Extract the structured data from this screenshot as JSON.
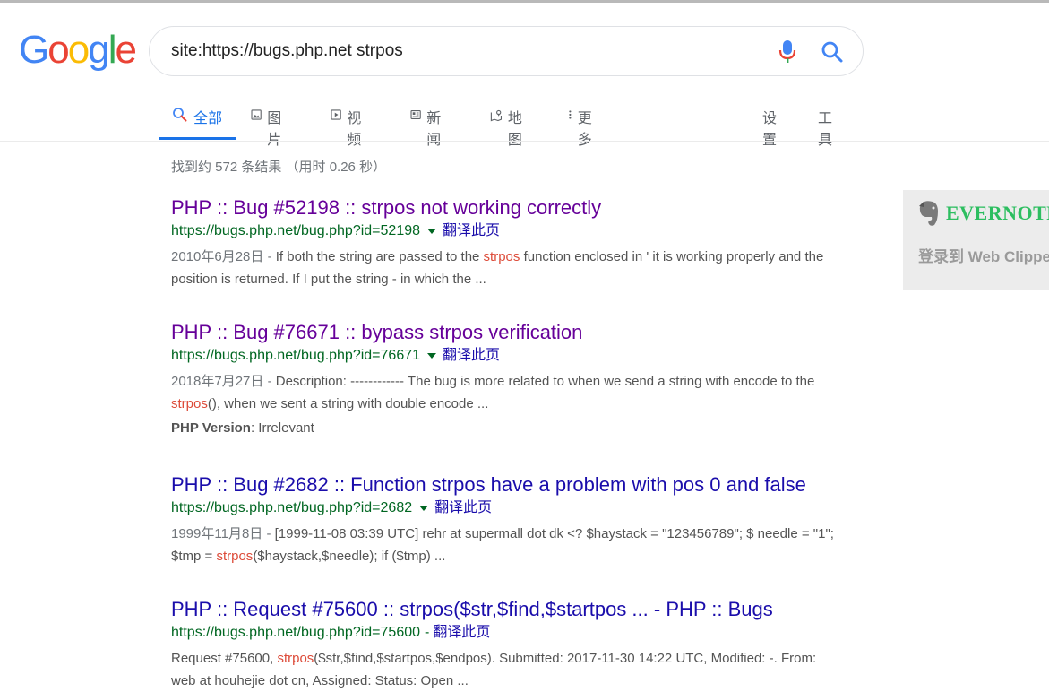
{
  "logo": {
    "letters": [
      "G",
      "o",
      "o",
      "g",
      "l",
      "e"
    ],
    "colors": [
      "#4285F4",
      "#EA4335",
      "#FBBC05",
      "#4285F4",
      "#34A853",
      "#EA4335"
    ]
  },
  "search": {
    "query": "site:https://bugs.php.net strpos"
  },
  "tabs": [
    {
      "label": "全部",
      "icon": "search-icon",
      "active": true
    },
    {
      "label": "图片",
      "icon": "image-icon"
    },
    {
      "label": "视频",
      "icon": "video-icon"
    },
    {
      "label": "新闻",
      "icon": "news-icon"
    },
    {
      "label": "地图",
      "icon": "map-icon"
    },
    {
      "label": "更多",
      "icon": "more-vert-icon"
    }
  ],
  "tools": {
    "settings": "设置",
    "tools": "工具"
  },
  "stats": "找到约 572 条结果 （用时 0.26 秒）",
  "results": [
    {
      "title": "PHP :: Bug #52198 :: strpos not working correctly",
      "visited": true,
      "url": "https://bugs.php.net/bug.php?id=52198",
      "translate": "翻译此页",
      "date": "2010年6月28日 - ",
      "snippet_parts": [
        "If both the string are passed to the ",
        "strpos",
        " function enclosed in ' it is working properly and the position is returned. If I put the string - in which the ..."
      ]
    },
    {
      "title": "PHP :: Bug #76671 :: bypass strpos verification",
      "visited": true,
      "url": "https://bugs.php.net/bug.php?id=76671",
      "translate": "翻译此页",
      "date": "2018年7月27日 - ",
      "snippet_parts": [
        "Description: ------------ The bug is more related to when we send a string with encode to the ",
        "strpos",
        "(), when we sent a string with double encode ..."
      ],
      "extra_label": "PHP Version",
      "extra_value": ": Irrelevant"
    },
    {
      "title": "PHP :: Bug #2682 :: Function strpos have a problem with pos 0 and false",
      "visited": false,
      "url": "https://bugs.php.net/bug.php?id=2682",
      "translate": "翻译此页",
      "date": "1999年11月8日 - ",
      "snippet_parts": [
        "[1999-11-08 03:39 UTC] rehr at supermall dot dk <? $haystack = \"123456789\"; $ needle = \"1\"; $tmp = ",
        "strpos",
        "($haystack,$needle); if ($tmp) ..."
      ]
    },
    {
      "title": "PHP :: Request #75600 :: strpos($str,$find,$startpos ... - PHP :: Bugs",
      "visited": false,
      "url": "https://bugs.php.net/bug.php?id=75600",
      "translate": "翻译此页",
      "date": "",
      "snippet_parts": [
        "Request #75600, ",
        "strpos",
        "($str,$find,$startpos,$endpos). Submitted: 2017-11-30 14:22 UTC, Modified: -. From: web at houhejie dot cn, Assigned: Status: Open ..."
      ]
    }
  ],
  "evernote": {
    "brand": "EVERNOTE",
    "login": "登录到 Web Clipper"
  }
}
